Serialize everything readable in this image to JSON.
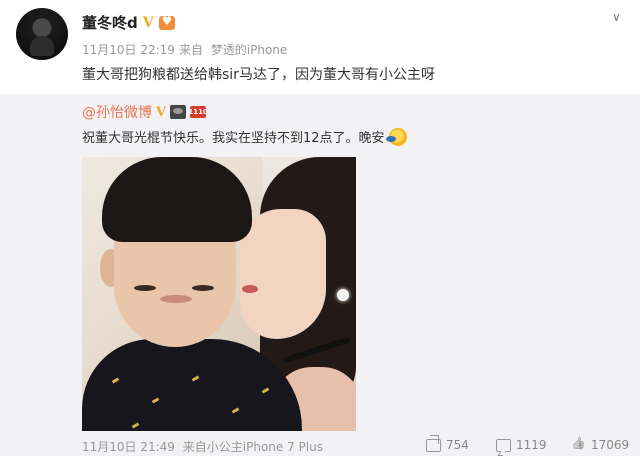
{
  "post": {
    "author": "董冬咚d",
    "verified_mark": "V",
    "time": "11月10日 22:19",
    "source_prefix": "来自",
    "source": "梦透的iPhone",
    "text": "董大哥把狗粮都送给韩sir马达了，因为董大哥有小公主呀",
    "dropdown": "∨"
  },
  "repost": {
    "author": "@孙怡微博",
    "verified_mark": "V",
    "badge2": "1110",
    "text": "祝董大哥光棍节快乐。我实在坚持不到12点了。晚安",
    "time": "11月10日 21:49",
    "source_prefix": "来自",
    "source": "小公主iPhone 7 Plus",
    "forwards": "754",
    "comments": "1119",
    "likes": "17069"
  }
}
